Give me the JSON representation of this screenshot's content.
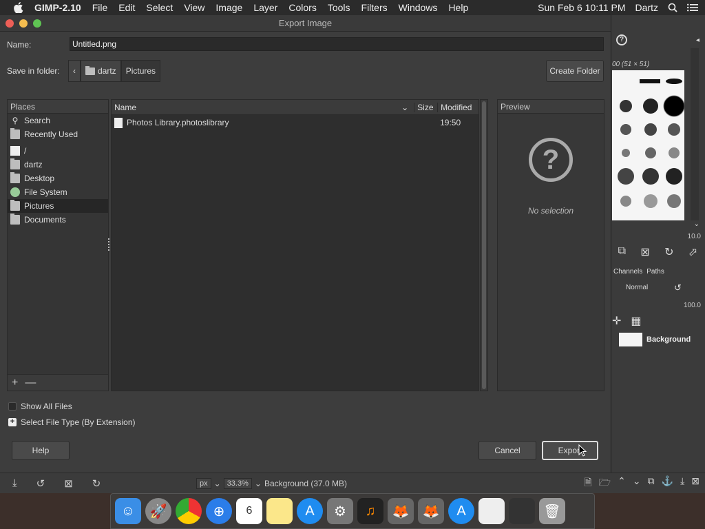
{
  "menubar": {
    "app": "GIMP-2.10",
    "items": [
      "File",
      "Edit",
      "Select",
      "View",
      "Image",
      "Layer",
      "Colors",
      "Tools",
      "Filters",
      "Windows",
      "Help"
    ],
    "clock": "Sun Feb 6  10:11 PM",
    "user": "Dartz"
  },
  "dialog": {
    "title": "Export Image",
    "name_label": "Name:",
    "name_value": "Untitled.png",
    "folder_label": "Save in folder:",
    "crumbs": [
      "dartz",
      "Pictures"
    ],
    "create_folder": "Create Folder",
    "places_header": "Places",
    "places": [
      "Search",
      "Recently Used",
      "/",
      "dartz",
      "Desktop",
      "File System",
      "Pictures",
      "Documents"
    ],
    "columns": {
      "name": "Name",
      "size": "Size",
      "modified": "Modified"
    },
    "files": [
      {
        "name": "Photos Library.photoslibrary",
        "size": "",
        "modified": "19:50"
      }
    ],
    "preview_header": "Preview",
    "preview_empty": "No selection",
    "show_all_files": "Show All Files",
    "select_file_type": "Select File Type (By Extension)",
    "help": "Help",
    "cancel": "Cancel",
    "export": "Export"
  },
  "statusbar": {
    "unit": "px",
    "zoom": "33.3%",
    "layer_info": "Background (37.0 MB)"
  },
  "dock": {
    "brush_title": "00 (51 × 51)",
    "spacing": "10.0",
    "tab_channels": "Channels",
    "tab_paths": "Paths",
    "mode": "Normal",
    "opacity": "100.0",
    "layer_name": "Background"
  }
}
